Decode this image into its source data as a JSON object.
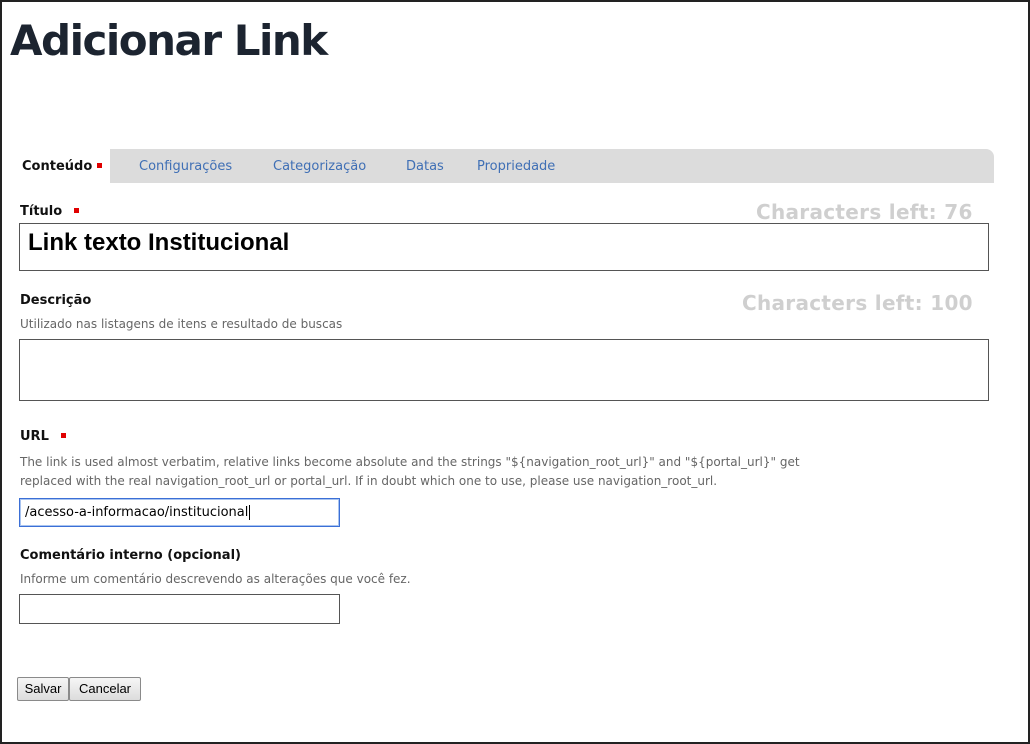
{
  "page": {
    "title": "Adicionar Link"
  },
  "tabs": [
    {
      "label": "Conteúdo",
      "active": true,
      "required": true
    },
    {
      "label": "Configurações"
    },
    {
      "label": "Categorização"
    },
    {
      "label": "Datas"
    },
    {
      "label": "Propriedade"
    }
  ],
  "fields": {
    "title": {
      "label": "Título",
      "required": true,
      "chars_left": "Characters left: 76",
      "value": "Link texto Institucional"
    },
    "description": {
      "label": "Descrição",
      "help": "Utilizado nas listagens de itens e resultado de buscas",
      "chars_left": "Characters left: 100",
      "value": ""
    },
    "url": {
      "label": "URL",
      "required": true,
      "help_line1": "The link is used almost verbatim, relative links become absolute and the strings \"${navigation_root_url}\" and \"${portal_url}\" get",
      "help_line2": "replaced with the real navigation_root_url or portal_url. If in doubt which one to use, please use navigation_root_url.",
      "value": "/acesso-a-informacao/institucional"
    },
    "comment": {
      "label": "Comentário interno (opcional)",
      "help": "Informe um comentário descrevendo as alterações que você fez.",
      "value": ""
    }
  },
  "buttons": {
    "save": "Salvar",
    "cancel": "Cancelar"
  },
  "colors": {
    "required_marker": "#e00000",
    "tab_link": "#3f6fb5",
    "tab_bar": "#dcdcdc"
  }
}
